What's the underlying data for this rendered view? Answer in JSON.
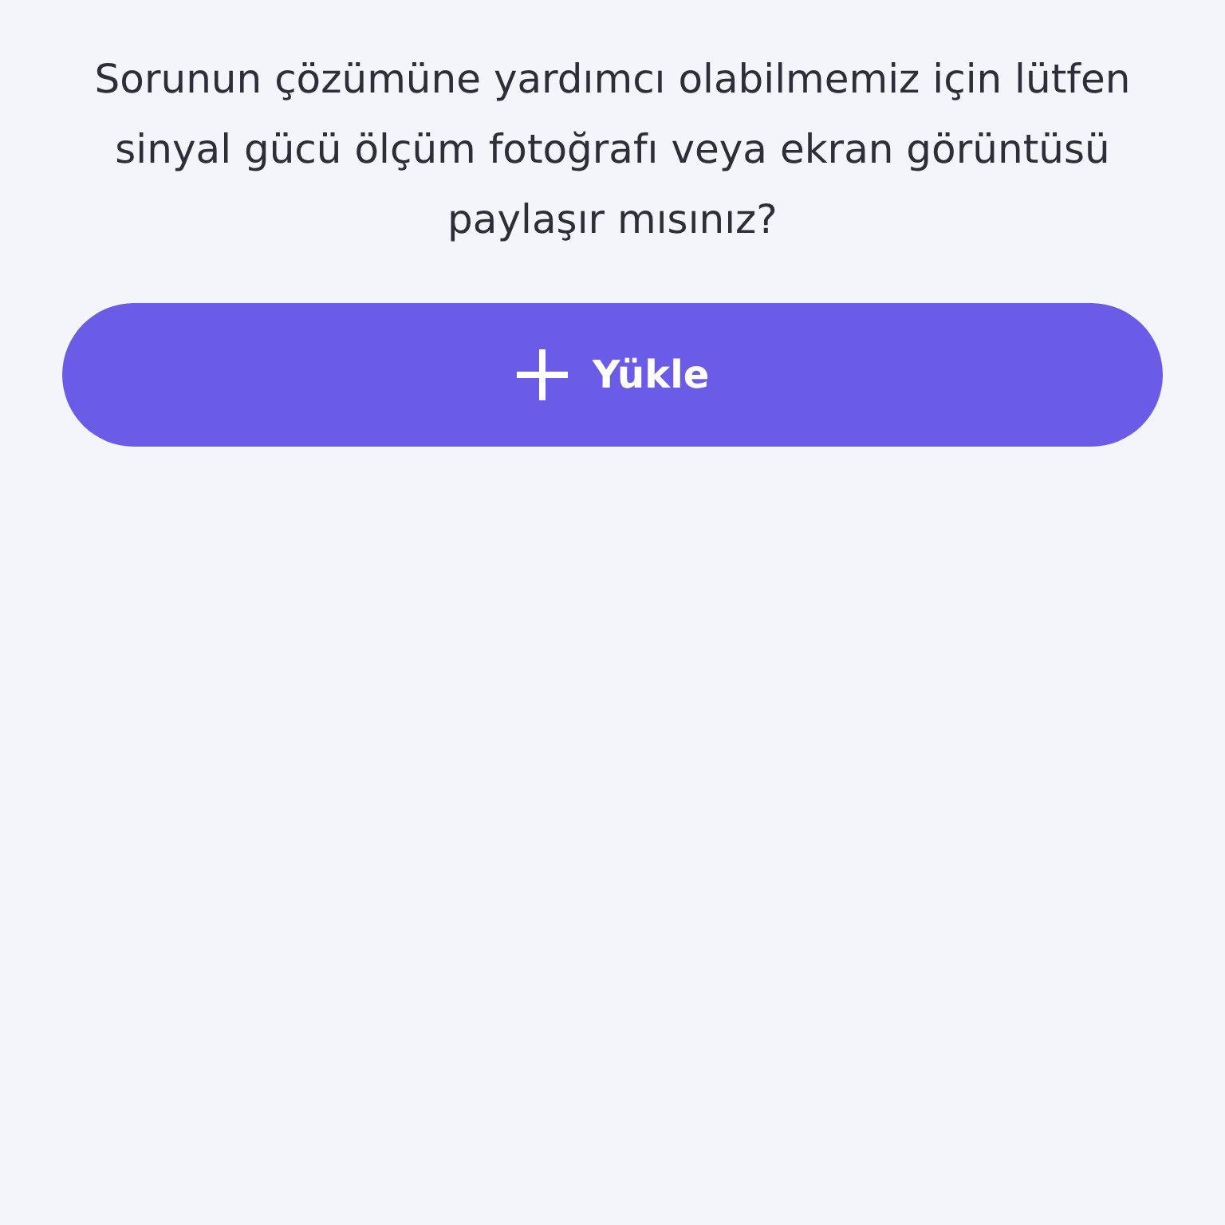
{
  "message": "Sorunun çözümüne yardımcı olabilmemiz için lütfen sinyal gücü ölçüm fotoğrafı veya ekran görüntüsü paylaşır mısınız?",
  "upload_button": {
    "label": "Yükle"
  }
}
